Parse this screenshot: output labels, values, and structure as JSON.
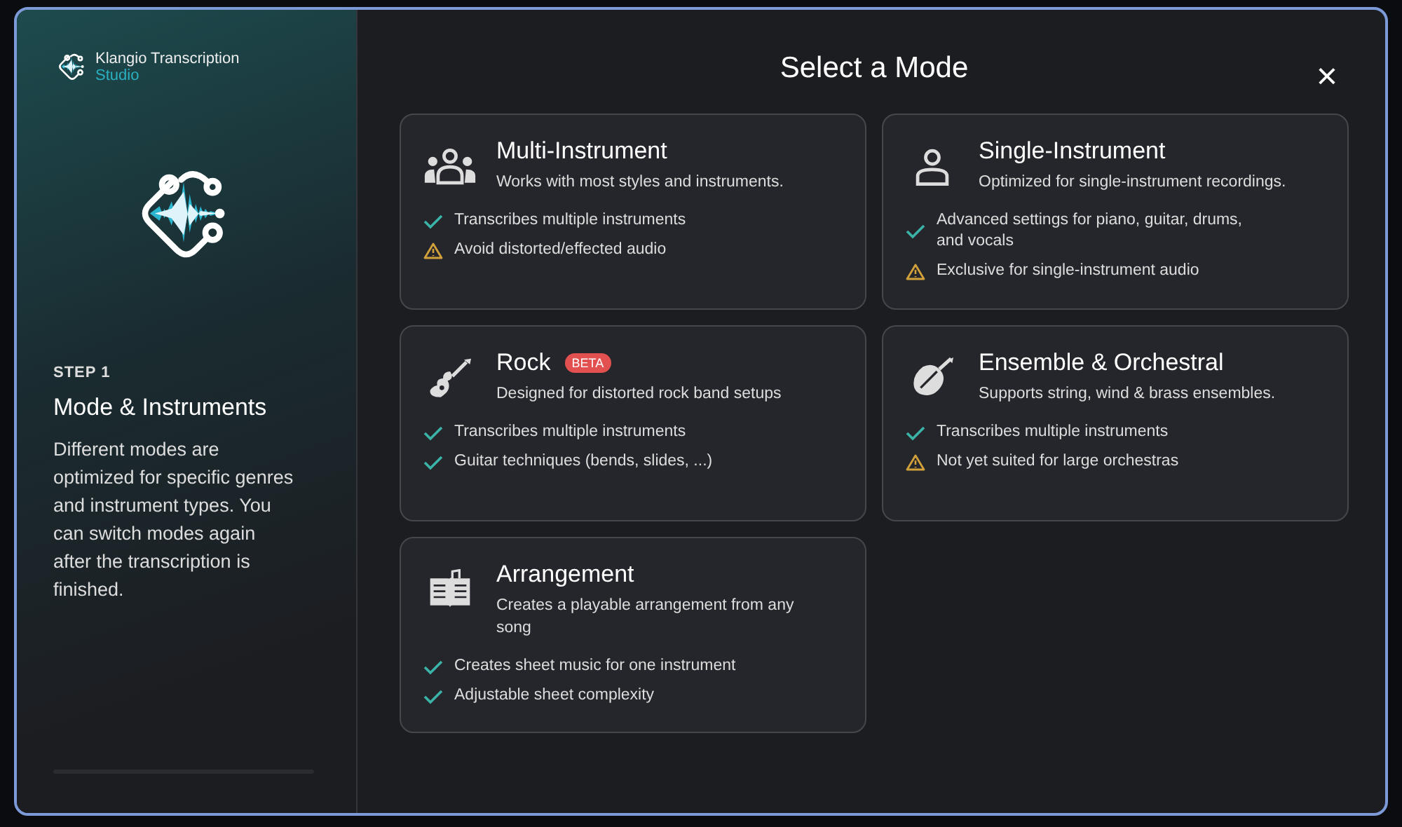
{
  "brand": {
    "name": "Klangio Transcription",
    "product": "Studio"
  },
  "step": {
    "label": "STEP 1",
    "title": "Mode & Instruments",
    "description": "Different modes are optimized for specific genres and instrument types. You can switch modes again after the transcription is finished."
  },
  "dialog": {
    "title": "Select a Mode",
    "close": "×"
  },
  "modes": [
    {
      "kind": "group",
      "title": "Multi-Instrument",
      "subtitle": "Works with most styles and instruments.",
      "features": [
        {
          "kind": "check",
          "text": "Transcribes multiple instruments"
        },
        {
          "kind": "warning",
          "text": "Avoid distorted/effected audio"
        }
      ]
    },
    {
      "kind": "person",
      "title": "Single-Instrument",
      "subtitle": "Optimized for single-instrument recordings.",
      "features": [
        {
          "kind": "check",
          "text": "Advanced settings for piano, guitar, drums, and vocals"
        },
        {
          "kind": "warning",
          "text": "Exclusive for single-instrument audio"
        }
      ]
    },
    {
      "kind": "guitar",
      "title": "Rock",
      "badge": "BETA",
      "subtitle": "Designed for distorted rock band setups",
      "features": [
        {
          "kind": "check",
          "text": "Transcribes multiple instruments"
        },
        {
          "kind": "check",
          "text": "Guitar techniques (bends, slides, ...)"
        }
      ]
    },
    {
      "kind": "violin",
      "title": "Ensemble & Orchestral",
      "subtitle": "Supports string, wind & brass ensembles.",
      "features": [
        {
          "kind": "check",
          "text": "Transcribes multiple instruments"
        },
        {
          "kind": "warning",
          "text": "Not yet suited for large orchestras"
        }
      ]
    },
    {
      "kind": "book",
      "title": "Arrangement",
      "subtitle": "Creates a playable arrangement from any song",
      "features": [
        {
          "kind": "check",
          "text": "Creates sheet music for one instrument"
        },
        {
          "kind": "check",
          "text": "Adjustable sheet complexity"
        }
      ]
    }
  ]
}
